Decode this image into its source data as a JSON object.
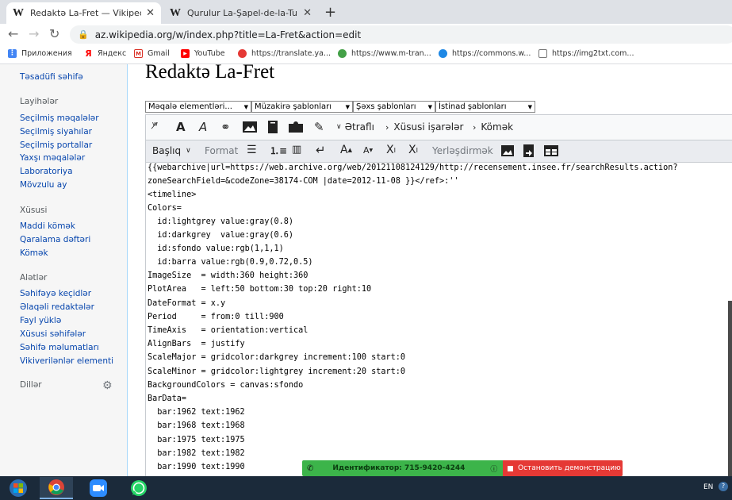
{
  "browser": {
    "tabs": [
      {
        "title": "Redaktə La-Fret — Vikipediya",
        "active": true
      },
      {
        "title": "Qurulur La-Şapel-de-la-Tur — Vi",
        "active": false
      }
    ],
    "close_glyph": "✕",
    "new_tab_glyph": "+",
    "url": "az.wikipedia.org/w/index.php?title=La-Fret&action=edit",
    "bookmarks": [
      {
        "label": "Приложения",
        "icon": "apps-grid-icon",
        "color": "#4285f4"
      },
      {
        "label": "Яндекс",
        "icon": "yandex-icon",
        "color": "#ff0000"
      },
      {
        "label": "Gmail",
        "icon": "gmail-icon",
        "color": "#d93025"
      },
      {
        "label": "YouTube",
        "icon": "youtube-icon",
        "color": "#ff0000"
      },
      {
        "label": "https://translate.ya...",
        "icon": "translate-icon",
        "color": "#e53935"
      },
      {
        "label": "https://www.m-tran...",
        "icon": "m-translate-icon",
        "color": "#43a047"
      },
      {
        "label": "https://commons.w...",
        "icon": "commons-icon",
        "color": "#1e88e5"
      },
      {
        "label": "https://img2txt.com...",
        "icon": "page-icon",
        "color": "#777777"
      }
    ]
  },
  "sidebar": {
    "top_link": "Təsadüfi səhifə",
    "sections": [
      {
        "heading": "Layihələr",
        "items": [
          "Seçilmiş məqalələr",
          "Seçilmiş siyahılar",
          "Seçilmiş portallar",
          "Yaxşı məqalələr",
          "Laboratoriya",
          "Mövzulu ay"
        ]
      },
      {
        "heading": "Xüsusi",
        "items": [
          "Maddi kömək",
          "Qaralama dəftəri",
          "Kömək"
        ]
      },
      {
        "heading": "Alətlər",
        "items": [
          "Səhifəyə keçidlər",
          "Əlaqəli redaktələr",
          "Fayl yüklə",
          "Xüsusi səhifələr",
          "Səhifə məlumatları",
          "Vikiverilənlər elementi"
        ]
      }
    ],
    "languages_heading": "Dillər"
  },
  "main": {
    "title": "Redaktə La-Fret",
    "dropdowns": [
      "Məqalə elementləri...",
      "Müzakirə şablonları",
      "Şəxs şablonları",
      "İstinad şablonları"
    ],
    "toolbar1": {
      "more_label": "Ətraflı",
      "special_chars_label": "Xüsusi işarələr",
      "help_label": "Kömək"
    },
    "toolbar2": {
      "format_menu": "Başlıq",
      "format_label": "Format",
      "placement_label": "Yerləşdirmək"
    },
    "editor_lines": [
      "{{webarchive|url=https://web.archive.org/web/20121108124129/http://recensement.insee.fr/searchResults.action?",
      "zoneSearchField=&codeZone=38174-COM |date=2012-11-08 }}</ref>:''",
      "<timeline>",
      "Colors=",
      "  id:lightgrey value:gray(0.8)",
      "  id:darkgrey  value:gray(0.6)",
      "  id:sfondo value:rgb(1,1,1)",
      "  id:barra value:rgb(0.9,0.72,0.5)",
      "ImageSize  = width:360 height:360",
      "PlotArea   = left:50 bottom:30 top:20 right:10",
      "DateFormat = x.y",
      "Period     = from:0 till:900",
      "TimeAxis   = orientation:vertical",
      "AlignBars  = justify",
      "ScaleMajor = gridcolor:darkgrey increment:100 start:0",
      "ScaleMinor = gridcolor:lightgrey increment:20 start:0",
      "BackgroundColors = canvas:sfondo",
      "BarData=",
      "  bar:1962 text:1962",
      "  bar:1968 text:1968",
      "  bar:1975 text:1975",
      "  bar:1982 text:1982",
      "  bar:1990 text:1990"
    ]
  },
  "overlay": {
    "identifier": "Идентификатор: 715-9420-4244",
    "stop_label": "Остановить демонстрацию"
  },
  "taskbar": {
    "apps": [
      "start-button",
      "chrome-icon",
      "zoom-icon",
      "whatsapp-icon"
    ],
    "language": "EN"
  },
  "colors": {
    "link": "#0645ad",
    "demo_bar": "#3cb44a",
    "stop_button": "#e53935",
    "taskbar": "#1b2a3a"
  }
}
